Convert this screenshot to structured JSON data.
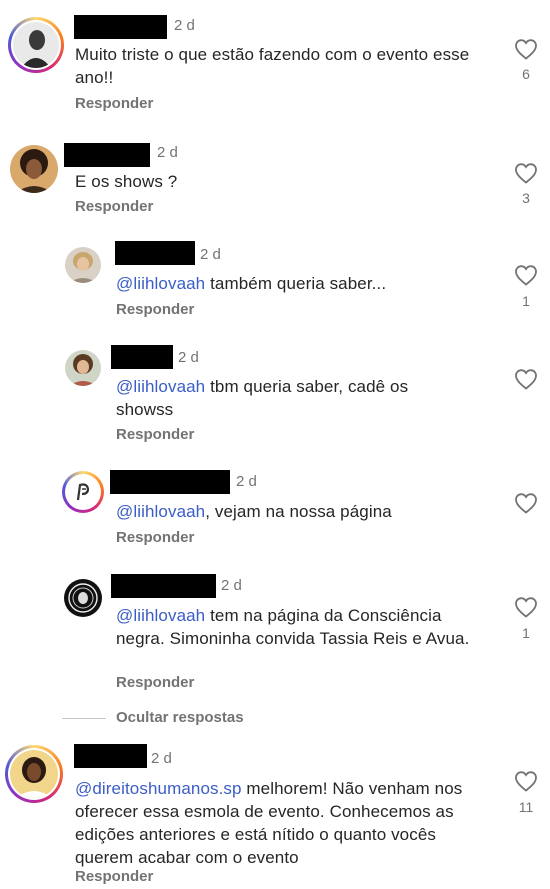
{
  "reply_label": "Responder",
  "hide_replies_label": "Ocultar respostas",
  "colors": {
    "mention": "#3b5dc6",
    "meta": "#737373",
    "text": "#262626"
  },
  "comments": [
    {
      "time": "2 d",
      "text": "Muito triste o que estão fazendo com o evento esse ano!!",
      "likes": "6",
      "level": "top"
    },
    {
      "time": "2 d",
      "text": "E os shows ?",
      "likes": "3",
      "level": "top"
    },
    {
      "time": "2 d",
      "mention": "@liihlovaah",
      "text": " também queria saber...",
      "likes": "1",
      "level": "reply"
    },
    {
      "time": "2 d",
      "mention": "@liihlovaah",
      "text": " tbm queria saber, cadê os showss",
      "likes": "",
      "level": "reply"
    },
    {
      "time": "2 d",
      "mention": "@liihlovaah",
      "text": ", vejam na nossa página",
      "likes": "",
      "level": "reply"
    },
    {
      "time": "2 d",
      "mention": "@liihlovaah",
      "text": " tem na página da Consciência negra. Simoninha convida  Tassia Reis e Avua.",
      "likes": "1",
      "level": "reply"
    },
    {
      "time": "2 d",
      "mention": "@direitoshumanos.sp",
      "text": " melhorem! Não venham nos oferecer essa esmola de evento. Conhecemos as edições anteriores e está nítido o quanto vocês querem acabar com o evento",
      "likes": "11",
      "level": "top"
    }
  ]
}
